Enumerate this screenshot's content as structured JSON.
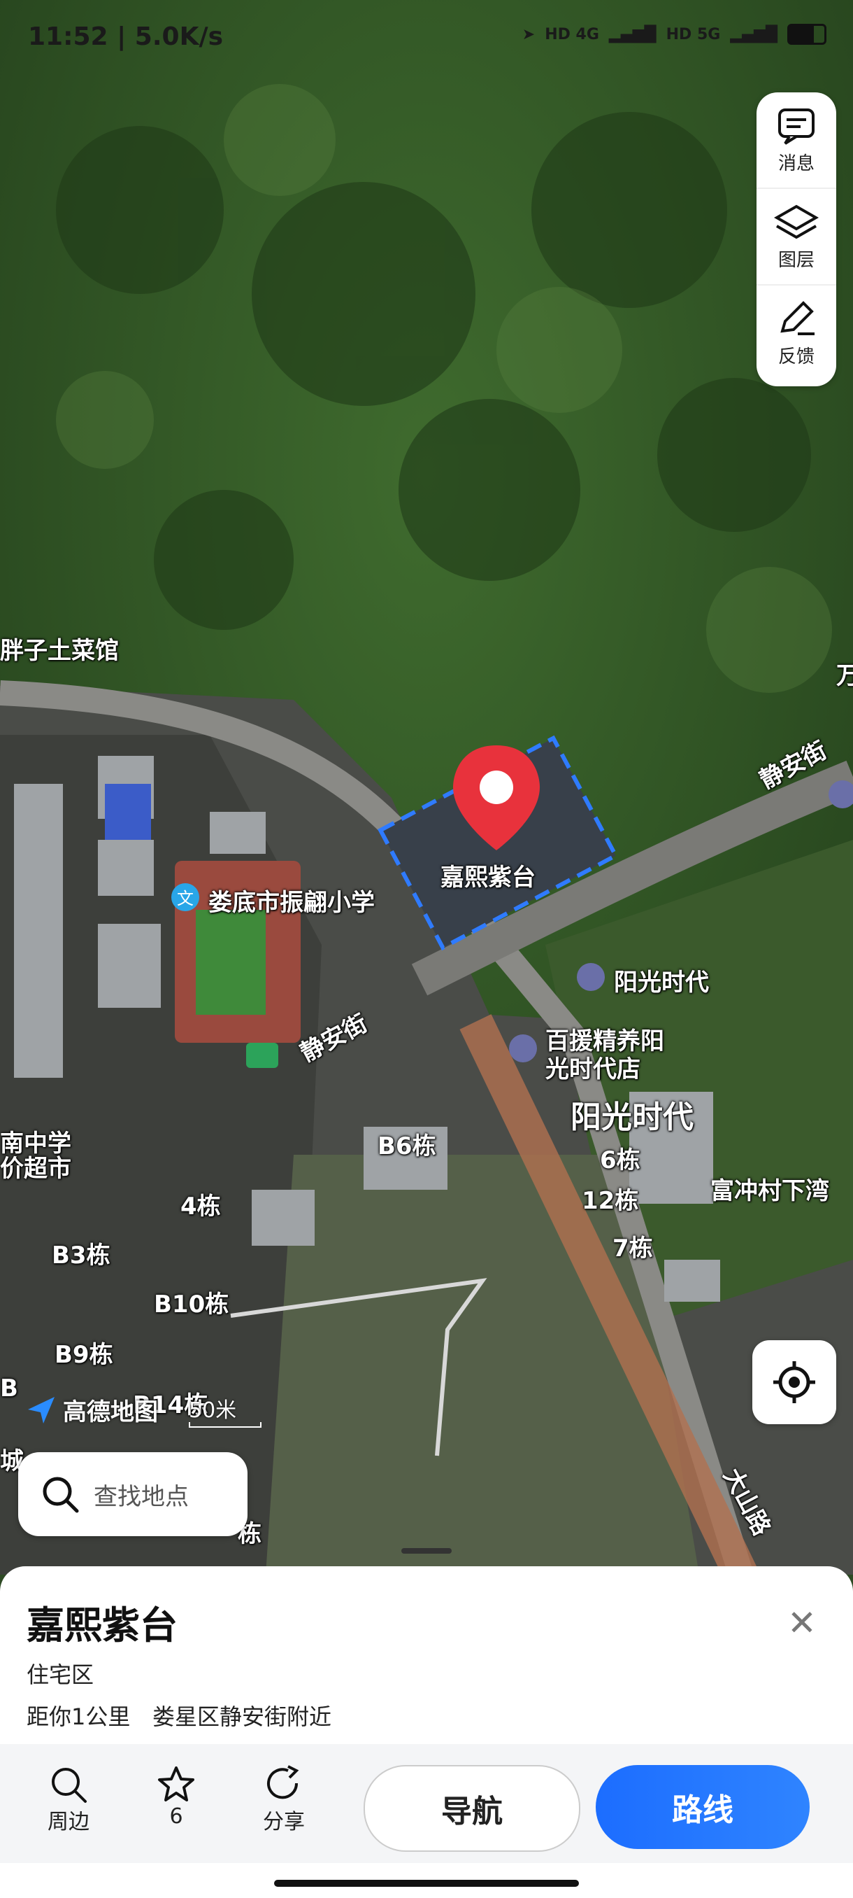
{
  "status_bar": {
    "time": "11:52 | 5.0K/s",
    "net1": "HD 4G",
    "net2": "HD 5G"
  },
  "map_tools": [
    {
      "label": "消息",
      "icon": "message-icon"
    },
    {
      "label": "图层",
      "icon": "layers-icon"
    },
    {
      "label": "反馈",
      "icon": "feedback-icon"
    }
  ],
  "map_labels": {
    "restaurant": "胖子土菜馆",
    "partial_top_right": "万",
    "road1": "静安街",
    "road2": "静安街",
    "school": "娄底市振翩小学",
    "target": "嘉熙紫台",
    "yg1": "阳光时代",
    "store_line1": "百援精养阳",
    "store_line2": "光时代店",
    "yg_big": "阳光时代",
    "b6": "B6栋",
    "d6": "6栋",
    "d12": "12栋",
    "d7": "7栋",
    "fuchong": "富冲村下湾",
    "mid_school_line1": "南中学",
    "mid_school_line2": "价超市",
    "d4": "4栋",
    "b3": "B3栋",
    "b10": "B10栋",
    "b9": "B9栋",
    "b14": "B14栋",
    "b_partial": "B",
    "cheng": "城",
    "bottom_partial": "栋",
    "dashan": "大山路"
  },
  "map_logo": "高德地图",
  "scale_label": "50米",
  "search": {
    "placeholder": "查找地点"
  },
  "poi": {
    "name": "嘉熙紫台",
    "type": "住宅区",
    "distance": "距你1公里",
    "address": "娄星区静安街附近"
  },
  "actions": {
    "nearby": "周边",
    "favorite_count": "6",
    "share": "分享",
    "navigate": "导航",
    "route": "路线"
  },
  "colors": {
    "route_blue": "#1c6dff",
    "pin_red": "#e8323c",
    "boundary_blue": "#2f7bff"
  }
}
